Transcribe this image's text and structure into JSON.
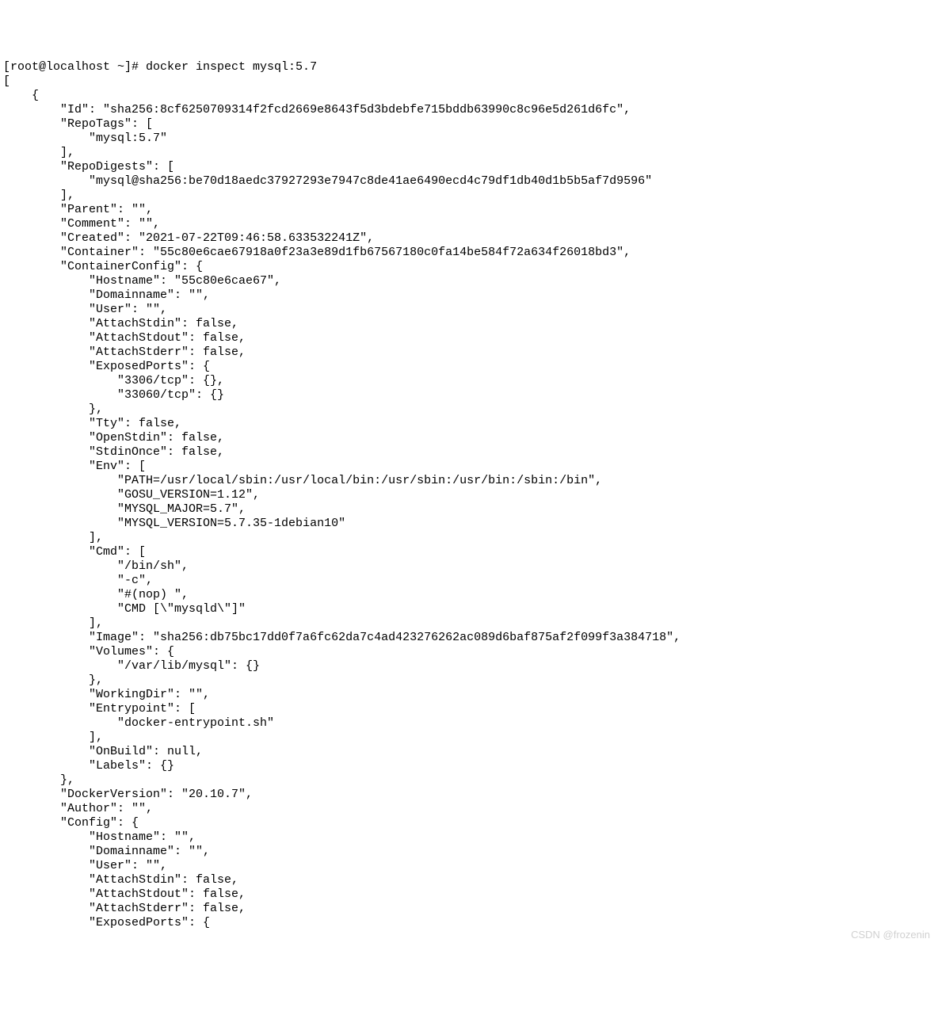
{
  "prompt": "[root@localhost ~]# docker inspect mysql:5.7",
  "output": {
    "open": "[",
    "item_open": "    {",
    "id_line": "        \"Id\": \"sha256:8cf6250709314f2fcd2669e8643f5d3bdebfe715bddb63990c8c96e5d261d6fc\",",
    "repotags_open": "        \"RepoTags\": [",
    "repotags_0": "            \"mysql:5.7\"",
    "repotags_close": "        ],",
    "repodigests_open": "        \"RepoDigests\": [",
    "repodigests_0": "            \"mysql@sha256:be70d18aedc37927293e7947c8de41ae6490ecd4c79df1db40d1b5b5af7d9596\"",
    "repodigests_close": "        ],",
    "parent": "        \"Parent\": \"\",",
    "comment": "        \"Comment\": \"\",",
    "created": "        \"Created\": \"2021-07-22T09:46:58.633532241Z\",",
    "container": "        \"Container\": \"55c80e6cae67918a0f23a3e89d1fb67567180c0fa14be584f72a634f26018bd3\",",
    "cc_open": "        \"ContainerConfig\": {",
    "cc_hostname": "            \"Hostname\": \"55c80e6cae67\",",
    "cc_domainname": "            \"Domainname\": \"\",",
    "cc_user": "            \"User\": \"\",",
    "cc_attachstdin": "            \"AttachStdin\": false,",
    "cc_attachstdout": "            \"AttachStdout\": false,",
    "cc_attachstderr": "            \"AttachStderr\": false,",
    "cc_exposed_open": "            \"ExposedPorts\": {",
    "cc_exposed_3306": "                \"3306/tcp\": {},",
    "cc_exposed_33060": "                \"33060/tcp\": {}",
    "cc_exposed_close": "            },",
    "cc_tty": "            \"Tty\": false,",
    "cc_openstdin": "            \"OpenStdin\": false,",
    "cc_stdinonce": "            \"StdinOnce\": false,",
    "cc_env_open": "            \"Env\": [",
    "cc_env_0": "                \"PATH=/usr/local/sbin:/usr/local/bin:/usr/sbin:/usr/bin:/sbin:/bin\",",
    "cc_env_1": "                \"GOSU_VERSION=1.12\",",
    "cc_env_2": "                \"MYSQL_MAJOR=5.7\",",
    "cc_env_3": "                \"MYSQL_VERSION=5.7.35-1debian10\"",
    "cc_env_close": "            ],",
    "cc_cmd_open": "            \"Cmd\": [",
    "cc_cmd_0": "                \"/bin/sh\",",
    "cc_cmd_1": "                \"-c\",",
    "cc_cmd_2": "                \"#(nop) \",",
    "cc_cmd_3": "                \"CMD [\\\"mysqld\\\"]\"",
    "cc_cmd_close": "            ],",
    "cc_image": "            \"Image\": \"sha256:db75bc17dd0f7a6fc62da7c4ad423276262ac089d6baf875af2f099f3a384718\",",
    "cc_volumes_open": "            \"Volumes\": {",
    "cc_volumes_0": "                \"/var/lib/mysql\": {}",
    "cc_volumes_close": "            },",
    "cc_workingdir": "            \"WorkingDir\": \"\",",
    "cc_entrypoint_open": "            \"Entrypoint\": [",
    "cc_entrypoint_0": "                \"docker-entrypoint.sh\"",
    "cc_entrypoint_close": "            ],",
    "cc_onbuild": "            \"OnBuild\": null,",
    "cc_labels": "            \"Labels\": {}",
    "cc_close": "        },",
    "dockerversion": "        \"DockerVersion\": \"20.10.7\",",
    "author": "        \"Author\": \"\",",
    "config_open": "        \"Config\": {",
    "config_hostname": "            \"Hostname\": \"\",",
    "config_domainname": "            \"Domainname\": \"\",",
    "config_user": "            \"User\": \"\",",
    "config_attachstdin": "            \"AttachStdin\": false,",
    "config_attachstdout": "            \"AttachStdout\": false,",
    "config_attachstderr": "            \"AttachStderr\": false,",
    "config_exposed_open": "            \"ExposedPorts\": {"
  },
  "watermark": "CSDN @frozenin"
}
